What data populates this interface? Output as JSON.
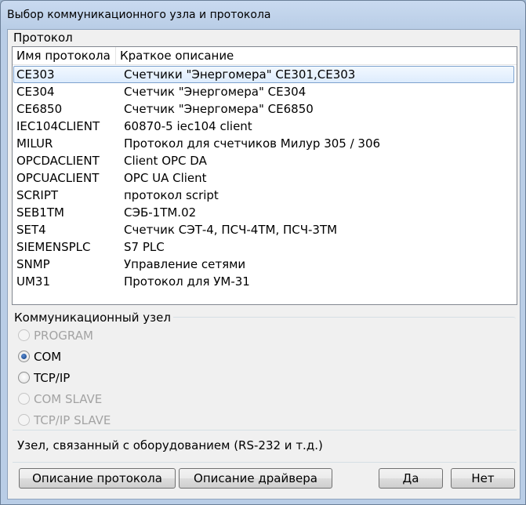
{
  "window": {
    "title": "Выбор коммуникационного узла и протокола"
  },
  "protocol_group": {
    "title": "Протокол",
    "columns": [
      "Имя протокола",
      "Краткое описание"
    ],
    "rows": [
      {
        "name": "CE303",
        "desc": "Счетчики \"Энергомера\" CE301,CE303",
        "selected": true
      },
      {
        "name": "CE304",
        "desc": "Счетчик \"Энергомера\" CE304"
      },
      {
        "name": "CE6850",
        "desc": "Счетчик \"Энергомера\" CE6850"
      },
      {
        "name": "IEC104CLIENT",
        "desc": "60870-5 iec104 client"
      },
      {
        "name": "MILUR",
        "desc": "Протокол для счетчиков Милур 305 / 306"
      },
      {
        "name": "OPCDACLIENT",
        "desc": "Client OPC DA"
      },
      {
        "name": "OPCUACLIENT",
        "desc": "OPC UA Client"
      },
      {
        "name": "SCRIPT",
        "desc": "протокол script"
      },
      {
        "name": "SEB1TM",
        "desc": "СЭБ-1ТМ.02"
      },
      {
        "name": "SET4",
        "desc": "Счетчик СЭТ-4, ПСЧ-4ТМ, ПСЧ-3ТМ"
      },
      {
        "name": "SIEMENSPLC",
        "desc": "S7 PLC"
      },
      {
        "name": "SNMP",
        "desc": "Управление сетями"
      },
      {
        "name": "UM31",
        "desc": "Протокол для УМ-31"
      }
    ]
  },
  "node_group": {
    "title": "Коммуникационный узел",
    "options": [
      {
        "label": "PROGRAM",
        "enabled": false,
        "checked": false
      },
      {
        "label": "COM",
        "enabled": true,
        "checked": true
      },
      {
        "label": "TCP/IP",
        "enabled": true,
        "checked": false
      },
      {
        "label": "COM SLAVE",
        "enabled": false,
        "checked": false
      },
      {
        "label": "TCP/IP SLAVE",
        "enabled": false,
        "checked": false
      }
    ]
  },
  "status_text": "Узел, связанный с оборудованием (RS-232 и т.д.)",
  "buttons": {
    "protocol_desc": "Описание протокола",
    "driver_desc": "Описание драйвера",
    "yes": "Да",
    "no": "Нет"
  }
}
